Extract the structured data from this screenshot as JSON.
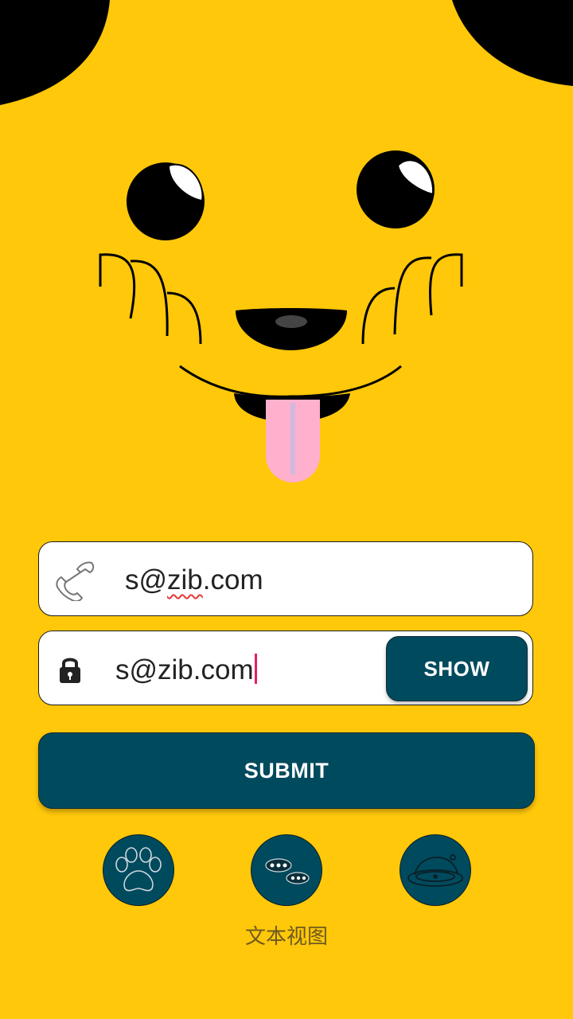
{
  "email_field": {
    "icon": "phone-icon",
    "value": "s@zib.com",
    "value_prefix": "s@",
    "value_misspelled": "zib",
    "value_suffix": ".com"
  },
  "password_field": {
    "icon": "lock-icon",
    "value": "s@zib.com",
    "toggle_label": "SHOW"
  },
  "submit": {
    "label": "SUBMIT"
  },
  "round_buttons": [
    {
      "icon": "paw-icon"
    },
    {
      "icon": "chat-bubbles-icon"
    },
    {
      "icon": "pet-bowl-icon"
    }
  ],
  "caption": "文本视图",
  "colors": {
    "background": "#FFC80A",
    "button": "#004A5E",
    "tongue": "#FFB0CC",
    "caret": "#E91E63"
  }
}
